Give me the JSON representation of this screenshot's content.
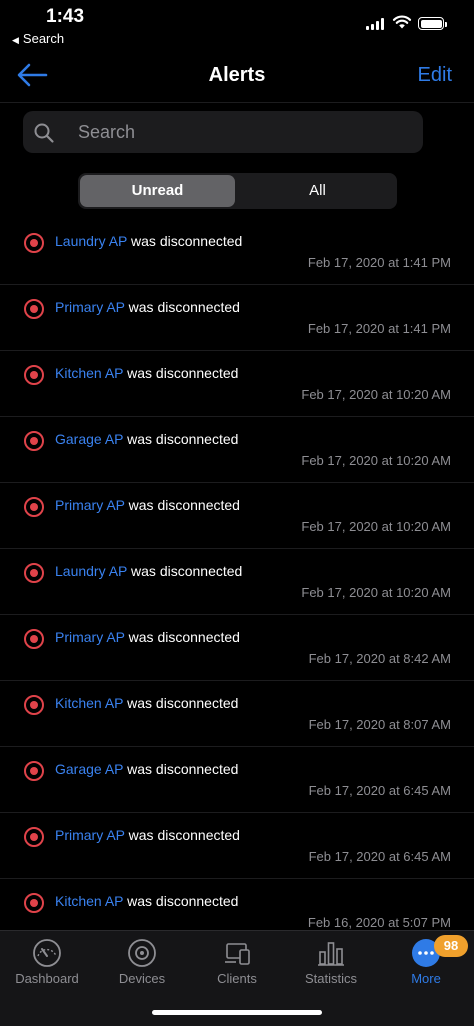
{
  "status_bar": {
    "time": "1:43",
    "back_app": "Search"
  },
  "nav": {
    "title": "Alerts",
    "edit_label": "Edit"
  },
  "search": {
    "placeholder": "Search"
  },
  "segment": {
    "unread": "Unread",
    "all": "All",
    "selected": "Unread"
  },
  "alerts": [
    {
      "device": "Laundry AP",
      "message": "was disconnected",
      "time": "Feb 17, 2020 at 1:41 PM"
    },
    {
      "device": "Primary AP",
      "message": "was disconnected",
      "time": "Feb 17, 2020 at 1:41 PM"
    },
    {
      "device": "Kitchen AP",
      "message": "was disconnected",
      "time": "Feb 17, 2020 at 10:20 AM"
    },
    {
      "device": "Garage AP",
      "message": "was disconnected",
      "time": "Feb 17, 2020 at 10:20 AM"
    },
    {
      "device": "Primary AP",
      "message": "was disconnected",
      "time": "Feb 17, 2020 at 10:20 AM"
    },
    {
      "device": "Laundry AP",
      "message": "was disconnected",
      "time": "Feb 17, 2020 at 10:20 AM"
    },
    {
      "device": "Primary AP",
      "message": "was disconnected",
      "time": "Feb 17, 2020 at 8:42 AM"
    },
    {
      "device": "Kitchen AP",
      "message": "was disconnected",
      "time": "Feb 17, 2020 at 8:07 AM"
    },
    {
      "device": "Garage AP",
      "message": "was disconnected",
      "time": "Feb 17, 2020 at 6:45 AM"
    },
    {
      "device": "Primary AP",
      "message": "was disconnected",
      "time": "Feb 17, 2020 at 6:45 AM"
    },
    {
      "device": "Kitchen AP",
      "message": "was disconnected",
      "time": "Feb 16, 2020 at 5:07 PM"
    }
  ],
  "tabs": [
    {
      "label": "Dashboard",
      "icon": "speedometer-icon"
    },
    {
      "label": "Devices",
      "icon": "device-icon"
    },
    {
      "label": "Clients",
      "icon": "clients-icon"
    },
    {
      "label": "Statistics",
      "icon": "statistics-icon"
    },
    {
      "label": "More",
      "icon": "more-icon",
      "badge": "98",
      "active": true
    }
  ],
  "colors": {
    "accent": "#2f7be6",
    "alert": "#e0434a",
    "badge": "#f0a02c",
    "device_link": "#3a82f0"
  }
}
